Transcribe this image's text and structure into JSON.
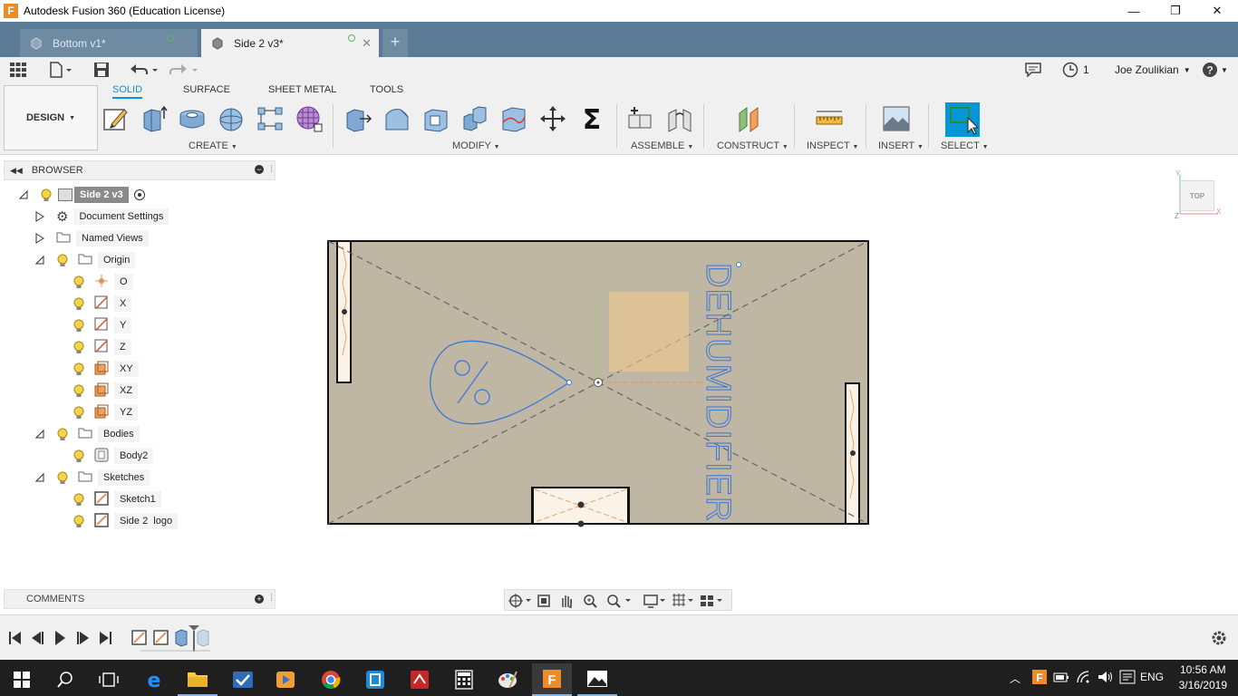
{
  "window": {
    "title": "Autodesk Fusion 360 (Education License)",
    "logo_letter": "F",
    "minimize": "—",
    "maximize": "❐",
    "close": "✕"
  },
  "tabs": [
    {
      "label": "Bottom v1*",
      "active": false
    },
    {
      "label": "Side 2 v3*",
      "active": true
    }
  ],
  "quick_access": {
    "jobs_count": "1",
    "user_name": "Joe Zoulikian"
  },
  "ribbon": {
    "workspace": "DESIGN",
    "tabs": [
      "SOLID",
      "SURFACE",
      "SHEET METAL",
      "TOOLS"
    ],
    "groups": [
      "CREATE",
      "MODIFY",
      "ASSEMBLE",
      "CONSTRUCT",
      "INSPECT",
      "INSERT",
      "SELECT"
    ]
  },
  "browser": {
    "title": "BROWSER",
    "root": "Side 2 v3",
    "items": [
      {
        "label": "Document Settings",
        "icon": "gear-icon"
      },
      {
        "label": "Named Views",
        "icon": "folder-icon"
      },
      {
        "label": "Origin",
        "icon": "folder-icon"
      },
      {
        "label": "O",
        "icon": "origin-point-icon"
      },
      {
        "label": "X",
        "icon": "axis-icon"
      },
      {
        "label": "Y",
        "icon": "axis-icon"
      },
      {
        "label": "Z",
        "icon": "axis-icon"
      },
      {
        "label": "XY",
        "icon": "plane-icon"
      },
      {
        "label": "XZ",
        "icon": "plane-icon"
      },
      {
        "label": "YZ",
        "icon": "plane-icon"
      },
      {
        "label": "Bodies",
        "icon": "folder-icon"
      },
      {
        "label": "Body2",
        "icon": "body-icon"
      },
      {
        "label": "Sketches",
        "icon": "folder-icon"
      },
      {
        "label": "Sketch1",
        "icon": "sketch-icon"
      },
      {
        "label": "Side 2  logo",
        "icon": "sketch-icon"
      }
    ]
  },
  "comments": {
    "title": "COMMENTS"
  },
  "viewcube": {
    "label": "TOP"
  },
  "sketch": {
    "text": "DEHUMIDIFIER",
    "logo_symbol": "%"
  },
  "taskbar": {
    "language": "ENG",
    "time": "10:56 AM",
    "date": "3/16/2019"
  },
  "colors": {
    "accent": "#0696d7",
    "body_fill": "#bfb6a3",
    "sketch_blue": "#3a78d8",
    "tabbar": "#5b7a96"
  }
}
